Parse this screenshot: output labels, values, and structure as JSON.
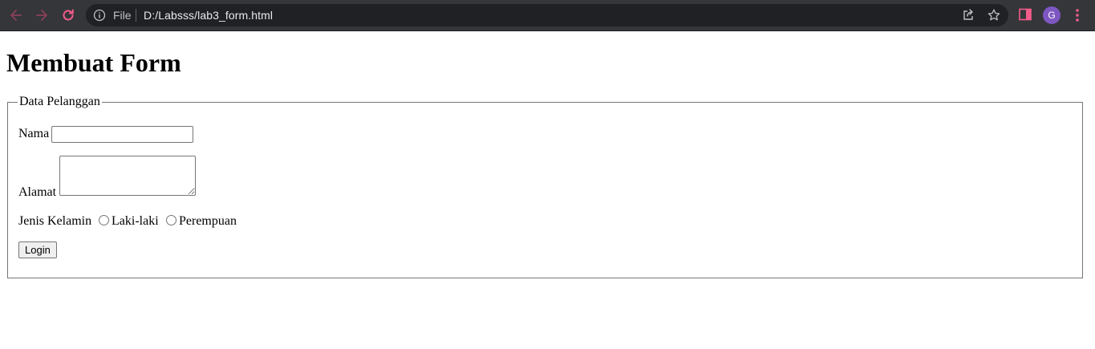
{
  "browser": {
    "omnibox": {
      "scheme_label": "File",
      "url": "D:/Labsss/lab3_form.html"
    },
    "profile_initial": "G",
    "colors": {
      "toolbar_bg": "#35363a",
      "omnibox_bg": "#202124",
      "accent_pink": "#f25c8a",
      "avatar_bg": "#7e57c2"
    },
    "icons": [
      "back-icon",
      "forward-icon",
      "reload-icon",
      "info-icon",
      "share-icon",
      "star-icon",
      "side-panel-icon",
      "menu-icon"
    ]
  },
  "page": {
    "heading": "Membuat Form",
    "fieldset": {
      "legend": "Data Pelanggan",
      "nama_label": "Nama",
      "nama_value": "",
      "alamat_label": "Alamat",
      "alamat_value": "",
      "gender_label": "Jenis Kelamin",
      "gender_options": [
        "Laki-laki",
        "Perempuan"
      ],
      "submit_label": "Login"
    }
  }
}
